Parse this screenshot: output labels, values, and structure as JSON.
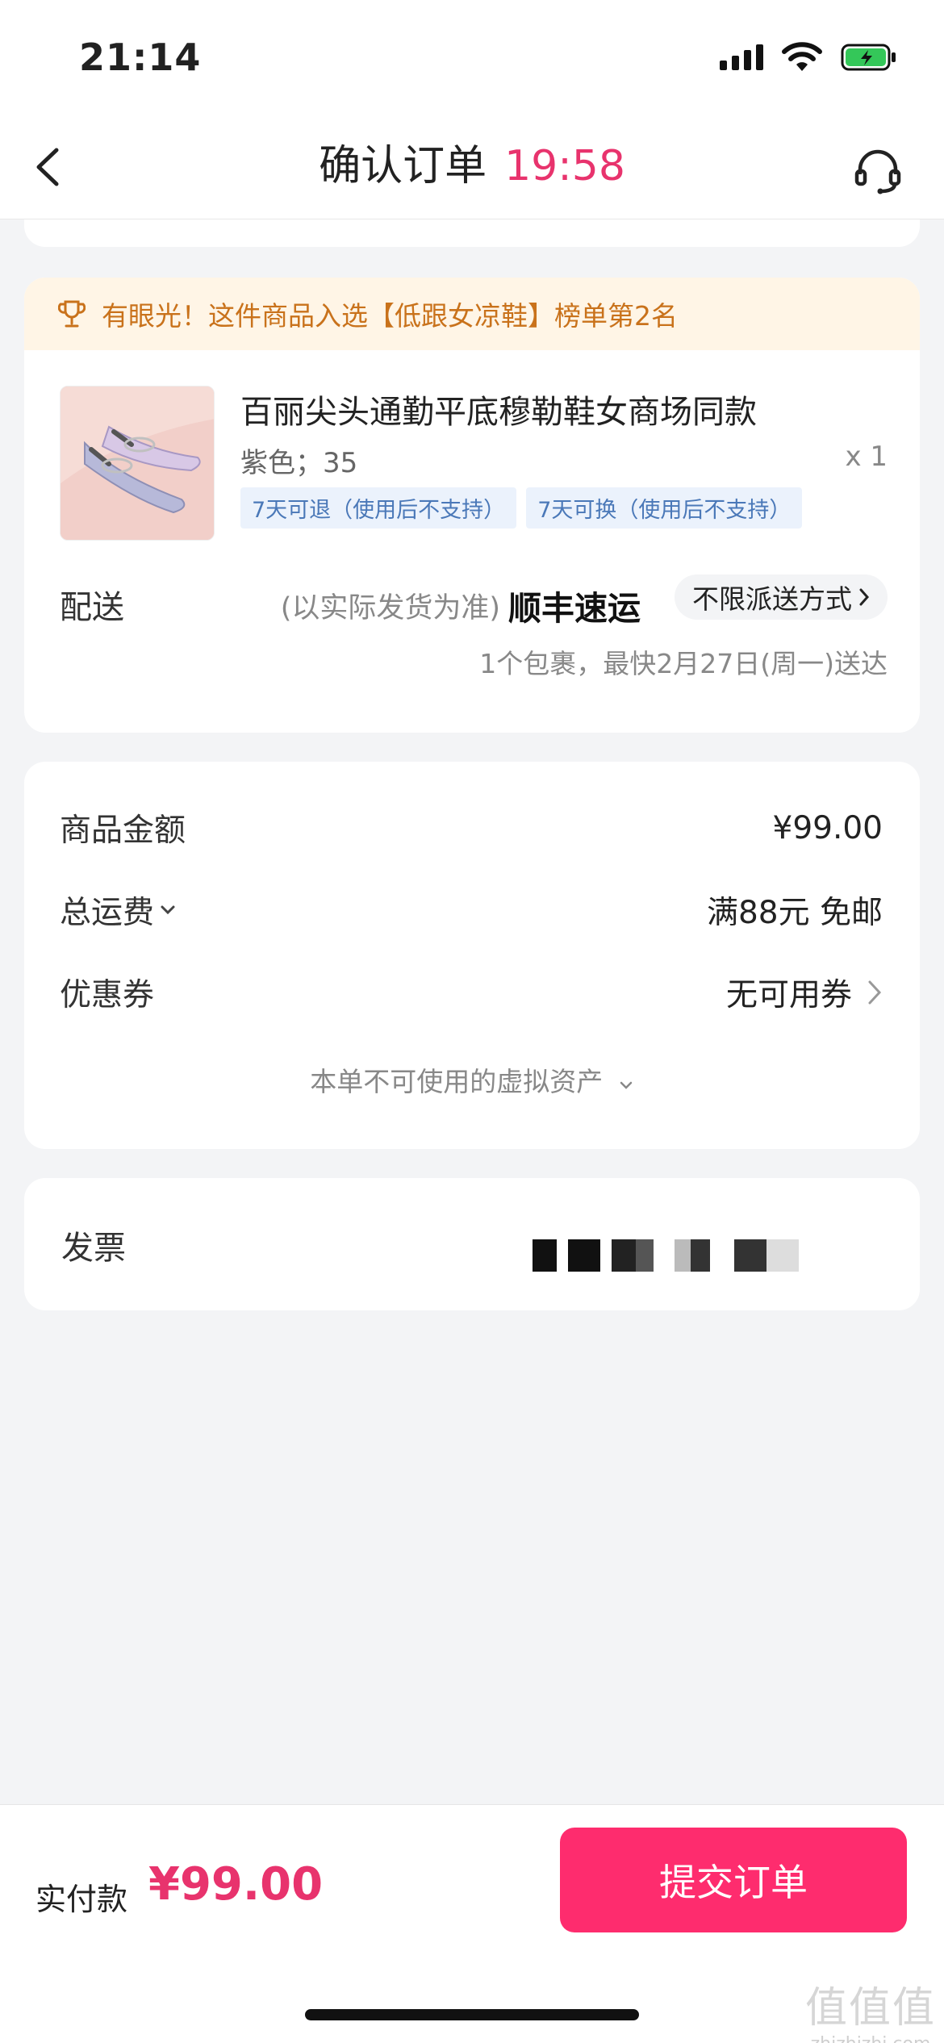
{
  "status_bar": {
    "time": "21:14"
  },
  "nav": {
    "title": "确认订单",
    "timer": "19:58"
  },
  "rank_banner": {
    "text": "有眼光！这件商品入选【低跟女凉鞋】榜单第2名"
  },
  "product": {
    "title": "百丽尖头通勤平底穆勒鞋女商场同款",
    "spec": "紫色；35",
    "qty": "x 1",
    "tags": [
      "7天可退（使用后不支持）",
      "7天可换（使用后不支持）"
    ]
  },
  "shipping": {
    "label": "配送",
    "note": "(以实际发货为准)",
    "carrier": "顺丰速运",
    "method": "不限派送方式",
    "eta": "1个包裹，最快2月27日(周一)送达"
  },
  "fees": {
    "goods_label": "商品金额",
    "goods_value": "¥99.00",
    "freight_label": "总运费",
    "freight_value": "满88元 免邮",
    "coupon_label": "优惠券",
    "coupon_value": "无可用券",
    "assets_text": "本单不可使用的虚拟资产"
  },
  "invoice": {
    "label": "发票"
  },
  "bottom": {
    "pay_label": "实付款",
    "pay_amount": "¥99.00",
    "submit_label": "提交订单"
  },
  "watermark": {
    "mark": "值值值",
    "site": "zhizhizhi.com"
  },
  "colors": {
    "accent": "#fe2c6e",
    "price": "#e8336d",
    "banner_text": "#c9721b",
    "tag_text": "#4a78b8"
  }
}
